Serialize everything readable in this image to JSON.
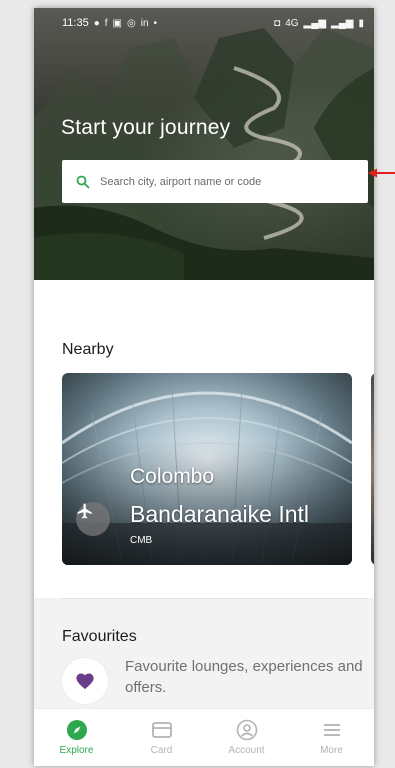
{
  "status_bar": {
    "time": "11:35",
    "left_icons": [
      "messenger-icon",
      "facebook-icon",
      "gallery-icon",
      "instagram-icon",
      "linkedin-icon",
      "dot-icon"
    ],
    "right_text": "4G"
  },
  "hero": {
    "title": "Start your journey",
    "search": {
      "placeholder": "Search city, airport name or code",
      "value": ""
    }
  },
  "nearby": {
    "title": "Nearby",
    "cards": [
      {
        "city": "Colombo",
        "airport": "Bandaranaike Intl",
        "code": "CMB"
      }
    ]
  },
  "favourites": {
    "title": "Favourites",
    "message": "Favourite lounges, experiences and offers."
  },
  "bottom_nav": {
    "items": [
      {
        "label": "Explore",
        "icon": "compass-icon",
        "active": true
      },
      {
        "label": "Card",
        "icon": "card-icon",
        "active": false
      },
      {
        "label": "Account",
        "icon": "account-icon",
        "active": false
      },
      {
        "label": "More",
        "icon": "menu-icon",
        "active": false
      }
    ]
  },
  "colors": {
    "accent": "#2ea84f",
    "favourite_heart": "#6b3c8a",
    "annotation_arrow": "#e0201b"
  }
}
